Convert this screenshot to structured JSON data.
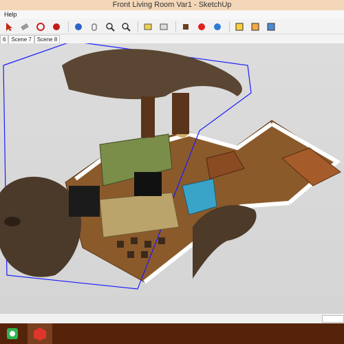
{
  "window": {
    "title": "Front Living Room Var1 - SketchUp"
  },
  "menu": {
    "items": [
      "Help"
    ]
  },
  "toolbar": {
    "icons": [
      "select-icon",
      "eraser-icon",
      "orbit-icon",
      "pan-icon",
      "zoom-icon",
      "zoom-extents-icon",
      "walk-icon",
      "section-icon",
      "component-icon",
      "paint-icon",
      "warehouse-icon",
      "layers-icon"
    ]
  },
  "scenes": {
    "tabs": [
      "6",
      "Scene 7",
      "Scene 8"
    ]
  },
  "taskbar": {
    "apps": [
      "windows-icon",
      "sketchup-icon"
    ]
  },
  "colors": {
    "floor": "#8b5a2b",
    "wall": "#ffffff",
    "selection": "#1a1aff",
    "taskbar": "#55230a",
    "titlebar": "#f3d7b8"
  }
}
